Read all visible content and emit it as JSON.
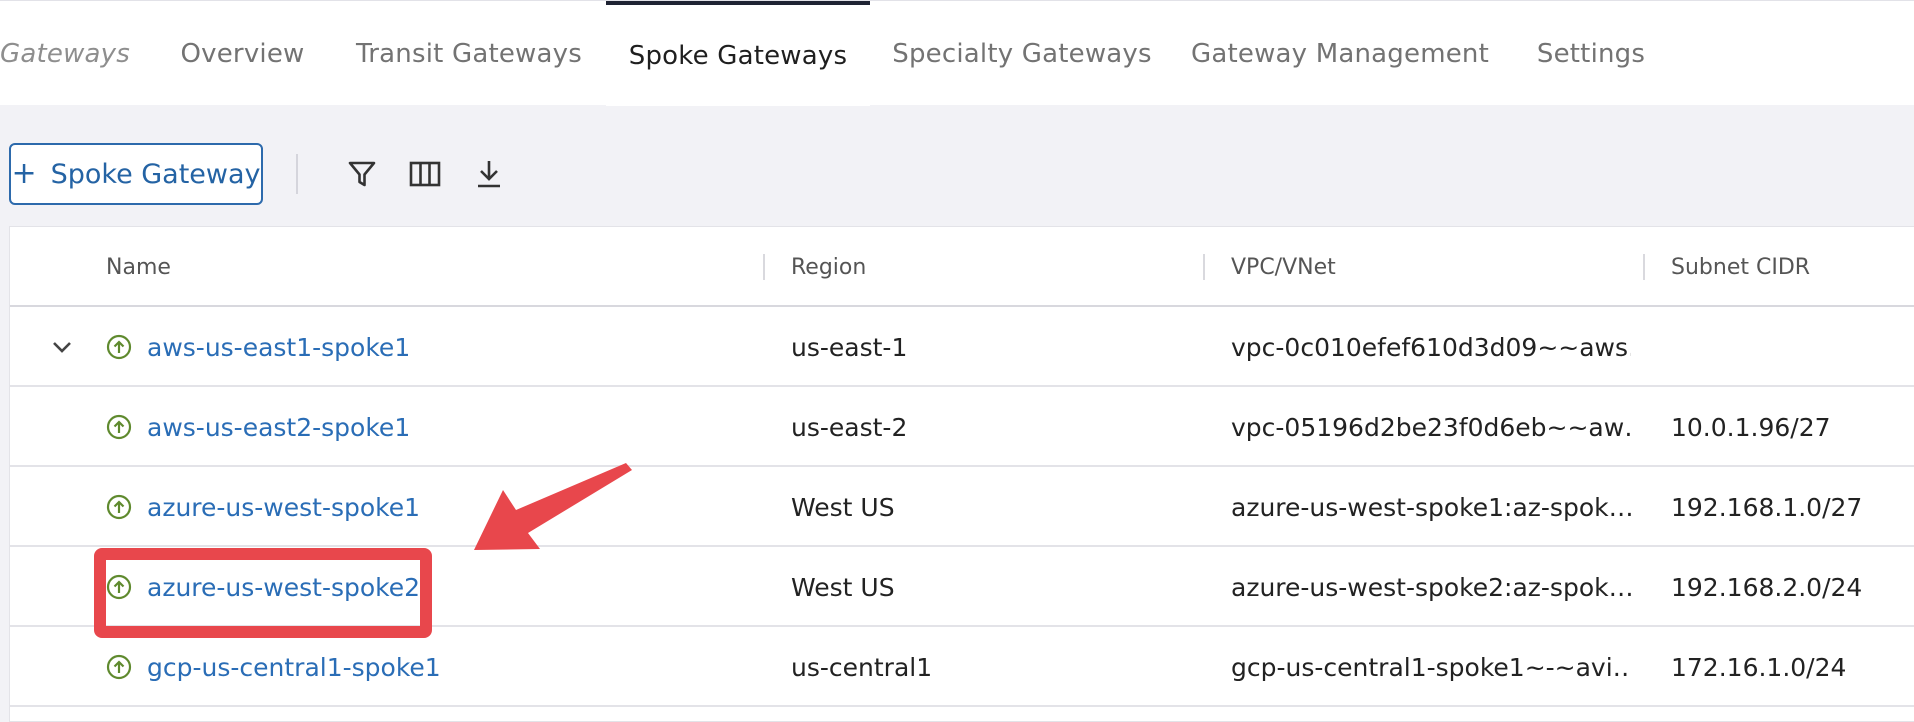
{
  "tabs": {
    "breadcrumb": "Gateways",
    "overview": "Overview",
    "transit": "Transit Gateways",
    "spoke": "Spoke Gateways",
    "specialty": "Specialty Gateways",
    "management": "Gateway Management",
    "settings": "Settings",
    "active": "Spoke Gateways"
  },
  "toolbar": {
    "add_label": "Spoke Gateway",
    "add_icon": "plus-icon",
    "icons": [
      "filter-icon",
      "columns-icon",
      "download-icon"
    ]
  },
  "table": {
    "columns": {
      "name": "Name",
      "region": "Region",
      "vpc": "VPC/VNet",
      "subnet": "Subnet CIDR"
    },
    "rows": [
      {
        "name": "aws-us-east1-spoke1",
        "region": "us-east-1",
        "vpc": "vpc-0c010efef610d3d09~~aws…",
        "subnet": "",
        "expandable": true
      },
      {
        "name": "aws-us-east2-spoke1",
        "region": "us-east-2",
        "vpc": "vpc-05196d2be23f0d6eb~~aw…",
        "subnet": "10.0.1.96/27"
      },
      {
        "name": "azure-us-west-spoke1",
        "region": "West US",
        "vpc": "azure-us-west-spoke1:az-spok…",
        "subnet": "192.168.1.0/27"
      },
      {
        "name": "azure-us-west-spoke2",
        "region": "West US",
        "vpc": "azure-us-west-spoke2:az-spok…",
        "subnet": "192.168.2.0/24",
        "highlighted": true
      },
      {
        "name": "gcp-us-central1-spoke1",
        "region": "us-central1",
        "vpc": "gcp-us-central1-spoke1~-~avi…",
        "subnet": "172.16.1.0/24"
      }
    ]
  },
  "colors": {
    "link": "#2a6db6",
    "status_up": "#5f8a2e",
    "annotation": "#e8474c",
    "active_tab_border": "#1f2333"
  }
}
